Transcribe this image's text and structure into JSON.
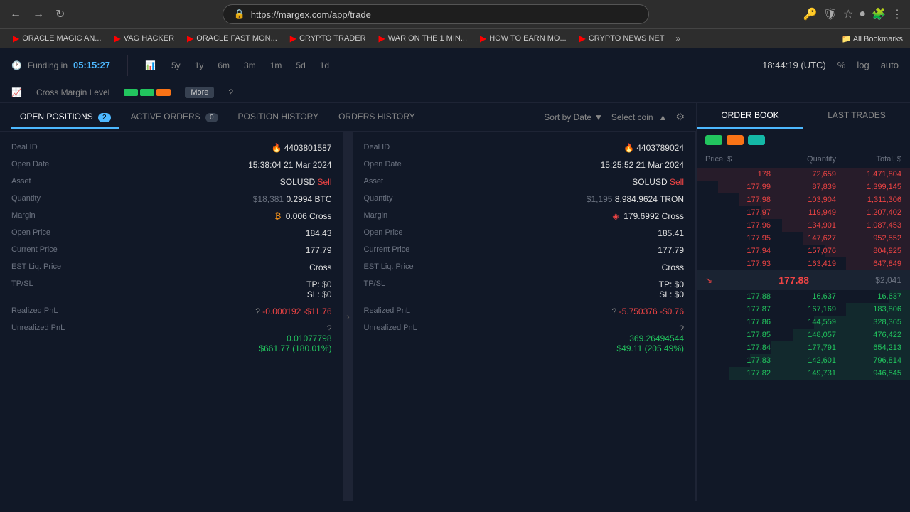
{
  "browser": {
    "url": "https://margex.com/app/trade",
    "nav_back": "←",
    "nav_forward": "→",
    "nav_refresh": "↻"
  },
  "bookmarks": [
    {
      "id": "bm1",
      "label": "ORACLE MAGIC AN...",
      "icon": "▶"
    },
    {
      "id": "bm2",
      "label": "VAG HACKER",
      "icon": "▶"
    },
    {
      "id": "bm3",
      "label": "ORACLE FAST MON...",
      "icon": "▶"
    },
    {
      "id": "bm4",
      "label": "CRYPTO TRADER",
      "icon": "▶"
    },
    {
      "id": "bm5",
      "label": "WAR ON THE 1 MIN...",
      "icon": "▶"
    },
    {
      "id": "bm6",
      "label": "HOW TO EARN MO...",
      "icon": "▶"
    },
    {
      "id": "bm7",
      "label": "CRYPTO NEWS NET",
      "icon": "▶"
    }
  ],
  "bookmarks_more": "»",
  "bookmarks_folder": "All Bookmarks",
  "header": {
    "timeframes": [
      "5y",
      "1y",
      "6m",
      "3m",
      "1m",
      "5d",
      "1d"
    ],
    "clock": "18:44:19 (UTC)",
    "pct": "%",
    "log": "log",
    "auto": "auto"
  },
  "funding": {
    "label": "Funding in",
    "time": "05:15:27"
  },
  "margin": {
    "label": "Cross Margin Level",
    "more": "More"
  },
  "tabs": {
    "open_positions": "OPEN POSITIONS",
    "open_positions_count": "2",
    "active_orders": "ACTIVE ORDERS",
    "active_orders_count": "0",
    "position_history": "POSITION HISTORY",
    "orders_history": "ORDERS HISTORY",
    "sort_label": "Sort by Date",
    "coin_label": "Select coin"
  },
  "position1": {
    "deal_id_label": "Deal ID",
    "deal_id": "4403801587",
    "open_date_label": "Open Date",
    "open_date": "15:38:04 21 Mar 2024",
    "asset_label": "Asset",
    "asset": "SOLUSD",
    "asset_side": "Sell",
    "quantity_label": "Quantity",
    "quantity_usd": "$18,381",
    "quantity_coin": "0.2994 BTC",
    "margin_label": "Margin",
    "margin_coin_amount": "0.006",
    "margin_type": "Cross",
    "open_price_label": "Open Price",
    "open_price": "184.43",
    "current_price_label": "Current Price",
    "current_price": "177.79",
    "est_liq_label": "EST Liq. Price",
    "est_liq": "Cross",
    "tp_sl_label": "TP/SL",
    "tp": "TP: $0",
    "sl": "SL: $0",
    "realized_pnl_label": "Realized PnL",
    "realized_pnl_coin": "-0.000192",
    "realized_pnl_usd": "-$11.76",
    "unrealized_pnl_label": "Unrealized PnL",
    "unrealized_pnl_coin": "0.01077798",
    "unrealized_pnl_usd": "$661.77 (180.01%)"
  },
  "position2": {
    "deal_id_label": "Deal ID",
    "deal_id": "4403789024",
    "open_date_label": "Open Date",
    "open_date": "15:25:52 21 Mar 2024",
    "asset_label": "Asset",
    "asset": "SOLUSD",
    "asset_side": "Sell",
    "quantity_label": "Quantity",
    "quantity_usd": "$1,195",
    "quantity_coin": "8,984.9624 TRON",
    "margin_label": "Margin",
    "margin_coin_amount": "179.6992",
    "margin_type": "Cross",
    "open_price_label": "Open Price",
    "open_price": "185.41",
    "current_price_label": "Current Price",
    "current_price": "177.79",
    "est_liq_label": "EST Liq. Price",
    "est_liq": "Cross",
    "tp_sl_label": "TP/SL",
    "tp": "TP: $0",
    "sl": "SL: $0",
    "realized_pnl_label": "Realized PnL",
    "realized_pnl_coin": "-5.750376",
    "realized_pnl_usd": "-$0.76",
    "unrealized_pnl_label": "Unrealized PnL",
    "unrealized_pnl_coin": "369.26494544",
    "unrealized_pnl_usd": "$49.11 (205.49%)"
  },
  "order_book": {
    "tab_order_book": "ORDER BOOK",
    "tab_last_trades": "LAST TRADES",
    "col_price": "Price, $",
    "col_quantity": "Quantity",
    "col_total": "Total, $",
    "asks": [
      {
        "price": "178",
        "quantity": "72,659",
        "total": "1,471,804"
      },
      {
        "price": "177.99",
        "quantity": "87,839",
        "total": "1,399,145"
      },
      {
        "price": "177.98",
        "quantity": "103,904",
        "total": "1,311,306"
      },
      {
        "price": "177.97",
        "quantity": "119,949",
        "total": "1,207,402"
      },
      {
        "price": "177.96",
        "quantity": "134,901",
        "total": "1,087,453"
      },
      {
        "price": "177.95",
        "quantity": "147,627",
        "total": "952,552"
      },
      {
        "price": "177.94",
        "quantity": "157,076",
        "total": "804,925"
      },
      {
        "price": "177.93",
        "quantity": "163,419",
        "total": "647,849"
      }
    ],
    "mid_price": "177.88",
    "mid_usd": "$2,041",
    "bids": [
      {
        "price": "177.88",
        "quantity": "16,637",
        "total": "16,637"
      },
      {
        "price": "177.87",
        "quantity": "167,169",
        "total": "183,806"
      },
      {
        "price": "177.86",
        "quantity": "144,559",
        "total": "328,365"
      },
      {
        "price": "177.85",
        "quantity": "148,057",
        "total": "476,422"
      },
      {
        "price": "177.84",
        "quantity": "177,791",
        "total": "654,213"
      },
      {
        "price": "177.83",
        "quantity": "142,601",
        "total": "796,814"
      },
      {
        "price": "177.82",
        "quantity": "149,731",
        "total": "946,545"
      }
    ]
  }
}
